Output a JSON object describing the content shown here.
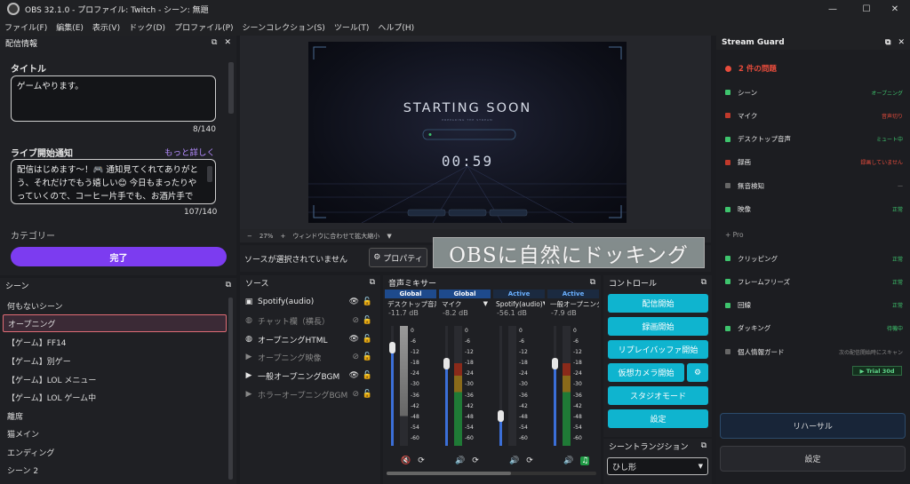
{
  "window": {
    "title": "OBS 32.1.0 - プロファイル: Twitch - シーン: 無題",
    "minimize": "—",
    "maximize": "☐",
    "close": "✕"
  },
  "menu": [
    "ファイル(F)",
    "編集(E)",
    "表示(V)",
    "ドック(D)",
    "プロファイル(P)",
    "シーンコレクション(S)",
    "ツール(T)",
    "ヘルプ(H)"
  ],
  "stream_info": {
    "header": "配信情報",
    "title_label": "タイトル",
    "title_value": "ゲームやります。",
    "title_count": "8/140",
    "notify_label": "ライブ開始通知",
    "more_link": "もっと詳しく",
    "notify_value": "配信はじめます〜！🎮 通知見てくれてありがとう、それだけでもう嬉しい😊 今日もまったりやっていくので、コーヒー片手でも、お酒片手でも、ぜひ遊びに来てね！",
    "notify_count": "107/140",
    "category_label": "カテゴリー",
    "done_button": "完了"
  },
  "preview": {
    "starting": "STARTING SOON",
    "sub": "PREPARING THE STREAM",
    "timer": "00:59",
    "zoom": "27%",
    "fit": "ウィンドウに合わせて拡大縮小"
  },
  "no_source": "ソースが選択されていません",
  "properties_button": "プロパティ",
  "overlay_text": "OBSに自然にドッキング",
  "scenes": {
    "header": "シーン",
    "items": [
      "何もないシーン",
      "オープニング",
      "【ゲーム】FF14",
      "【ゲーム】別ゲー",
      "【ゲーム】LOL メニュー",
      "【ゲーム】LOL ゲーム中",
      "離席",
      "猫メイン",
      "エンディング",
      "シーン 2"
    ]
  },
  "sources": {
    "header": "ソース",
    "items": [
      {
        "icon": "speaker",
        "label": "Spotify(audio)",
        "visible": true
      },
      {
        "icon": "globe",
        "label": "チャット欄（横長）",
        "visible": false
      },
      {
        "icon": "globe",
        "label": "オープニングHTML",
        "visible": true
      },
      {
        "icon": "play",
        "label": "オープニング映像",
        "visible": false
      },
      {
        "icon": "play",
        "label": "一般オープニングBGM",
        "visible": true
      },
      {
        "icon": "play",
        "label": "ホラーオープニングBGM",
        "visible": false
      }
    ]
  },
  "mixer": {
    "header": "音声ミキサー",
    "ticks": [
      "0",
      "-6",
      "-12",
      "-18",
      "-24",
      "-30",
      "-36",
      "-42",
      "-48",
      "-54",
      "-60"
    ],
    "channels": [
      {
        "tag": "Global",
        "name": "デスクトップ音声",
        "db": "-11.7 dB",
        "level": 0.82,
        "muted": true
      },
      {
        "tag": "Global",
        "name": "マイク",
        "db": "-8.2 dB",
        "level": 0.69,
        "muted": false
      },
      {
        "tag": "Active",
        "name": "Spotify(audio)",
        "db": "-56.1 dB",
        "level": 0.25,
        "muted": false
      },
      {
        "tag": "Active",
        "name": "一般オープニングBGM",
        "db": "-7.9 dB",
        "level": 0.69,
        "muted": false
      }
    ]
  },
  "controls": {
    "header": "コントロール",
    "buttons": [
      "配信開始",
      "録画開始",
      "リプレイバッファ開始",
      "仮想カメラ開始",
      "スタジオモード",
      "設定"
    ]
  },
  "transition": {
    "header": "シーントランジション",
    "value": "ひし形"
  },
  "guard": {
    "header": "Stream Guard",
    "issues": "2 件の問題",
    "items": [
      {
        "label": "シーン",
        "status": "オープニング",
        "color": "#3ec46d",
        "scolor": "#3ec46d"
      },
      {
        "label": "マイク",
        "status": "音声切り",
        "color": "#c0392b",
        "scolor": "#e74c3c"
      },
      {
        "label": "デスクトップ音声",
        "status": "ミュート中",
        "color": "#3ec46d",
        "scolor": "#3ec46d"
      },
      {
        "label": "録画",
        "status": "録画していません",
        "color": "#c0392b",
        "scolor": "#e74c3c"
      },
      {
        "label": "無音検知",
        "status": "—",
        "color": "#666",
        "scolor": "#888"
      },
      {
        "label": "映像",
        "status": "正常",
        "color": "#3ec46d",
        "scolor": "#3ec46d"
      }
    ],
    "pro_label": "+ Pro",
    "pro_items": [
      {
        "label": "クリッピング",
        "status": "正常",
        "color": "#3ec46d",
        "scolor": "#3ec46d"
      },
      {
        "label": "フレームフリーズ",
        "status": "正常",
        "color": "#3ec46d",
        "scolor": "#3ec46d"
      },
      {
        "label": "回線",
        "status": "正常",
        "color": "#3ec46d",
        "scolor": "#3ec46d"
      },
      {
        "label": "ダッキング",
        "status": "待機中",
        "color": "#3ec46d",
        "scolor": "#3ec46d"
      },
      {
        "label": "個人情報ガード",
        "status": "次の配信開始時にスキャン",
        "color": "#666",
        "scolor": "#888"
      }
    ],
    "trial": "▶ Trial 30d",
    "rehearsal": "リハーサル",
    "settings": "設定"
  }
}
